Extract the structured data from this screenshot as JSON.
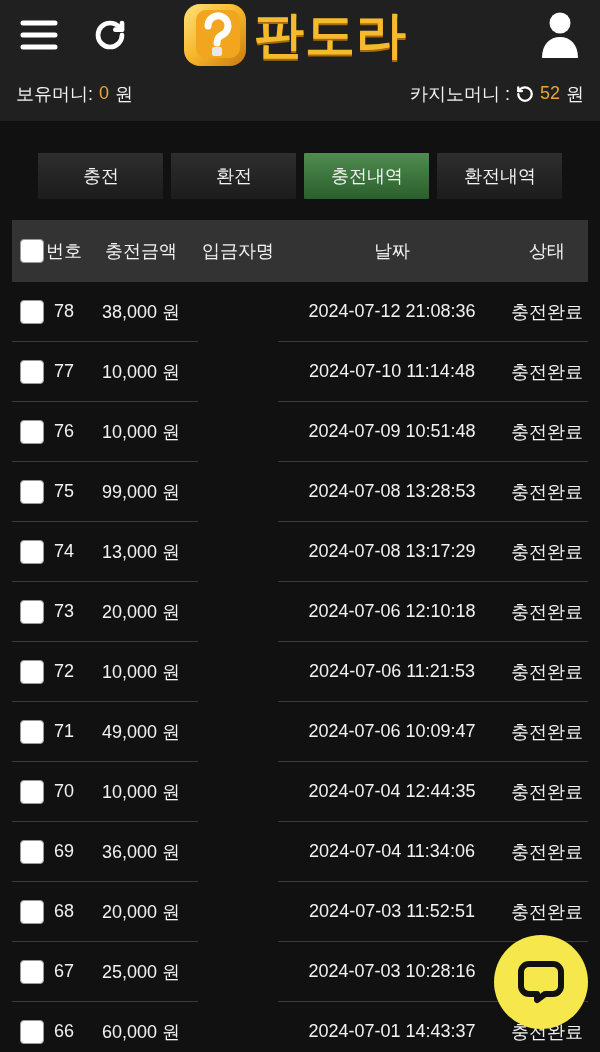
{
  "header": {
    "logo_text": "판도라"
  },
  "balance": {
    "wallet": {
      "label": "보유머니:",
      "amount": "0",
      "unit": "원"
    },
    "casino": {
      "label": "카지노머니 :",
      "amount": "52",
      "unit": "원"
    }
  },
  "tabs": [
    {
      "label": "충전",
      "selected": false
    },
    {
      "label": "환전",
      "selected": false
    },
    {
      "label": "충전내역",
      "selected": true
    },
    {
      "label": "환전내역",
      "selected": false
    }
  ],
  "table": {
    "select_all": {
      "checked": false
    },
    "columns": [
      "번호",
      "충전금액",
      "입금자명",
      "날짜",
      "상태"
    ],
    "rows": [
      {
        "checked": false,
        "number": "78",
        "amount": "38,000 원",
        "date": "2024-07-12 21:08:36",
        "status": "충전완료"
      },
      {
        "checked": false,
        "number": "77",
        "amount": "10,000 원",
        "date": "2024-07-10 11:14:48",
        "status": "충전완료"
      },
      {
        "checked": false,
        "number": "76",
        "amount": "10,000 원",
        "date": "2024-07-09 10:51:48",
        "status": "충전완료"
      },
      {
        "checked": false,
        "number": "75",
        "amount": "99,000 원",
        "date": "2024-07-08 13:28:53",
        "status": "충전완료"
      },
      {
        "checked": false,
        "number": "74",
        "amount": "13,000 원",
        "date": "2024-07-08 13:17:29",
        "status": "충전완료"
      },
      {
        "checked": false,
        "number": "73",
        "amount": "20,000 원",
        "date": "2024-07-06 12:10:18",
        "status": "충전완료"
      },
      {
        "checked": false,
        "number": "72",
        "amount": "10,000 원",
        "date": "2024-07-06 11:21:53",
        "status": "충전완료"
      },
      {
        "checked": false,
        "number": "71",
        "amount": "49,000 원",
        "date": "2024-07-06 10:09:47",
        "status": "충전완료"
      },
      {
        "checked": false,
        "number": "70",
        "amount": "10,000 원",
        "date": "2024-07-04 12:44:35",
        "status": "충전완료"
      },
      {
        "checked": false,
        "number": "69",
        "amount": "36,000 원",
        "date": "2024-07-04 11:34:06",
        "status": "충전완료"
      },
      {
        "checked": false,
        "number": "68",
        "amount": "20,000 원",
        "date": "2024-07-03 11:52:51",
        "status": "충전완료"
      },
      {
        "checked": false,
        "number": "67",
        "amount": "25,000 원",
        "date": "2024-07-03 10:28:16"
      },
      {
        "checked": false,
        "number": "66",
        "amount": "60,000 원",
        "date": "2024-07-01 14:43:37",
        "status": "충전완료"
      }
    ]
  }
}
